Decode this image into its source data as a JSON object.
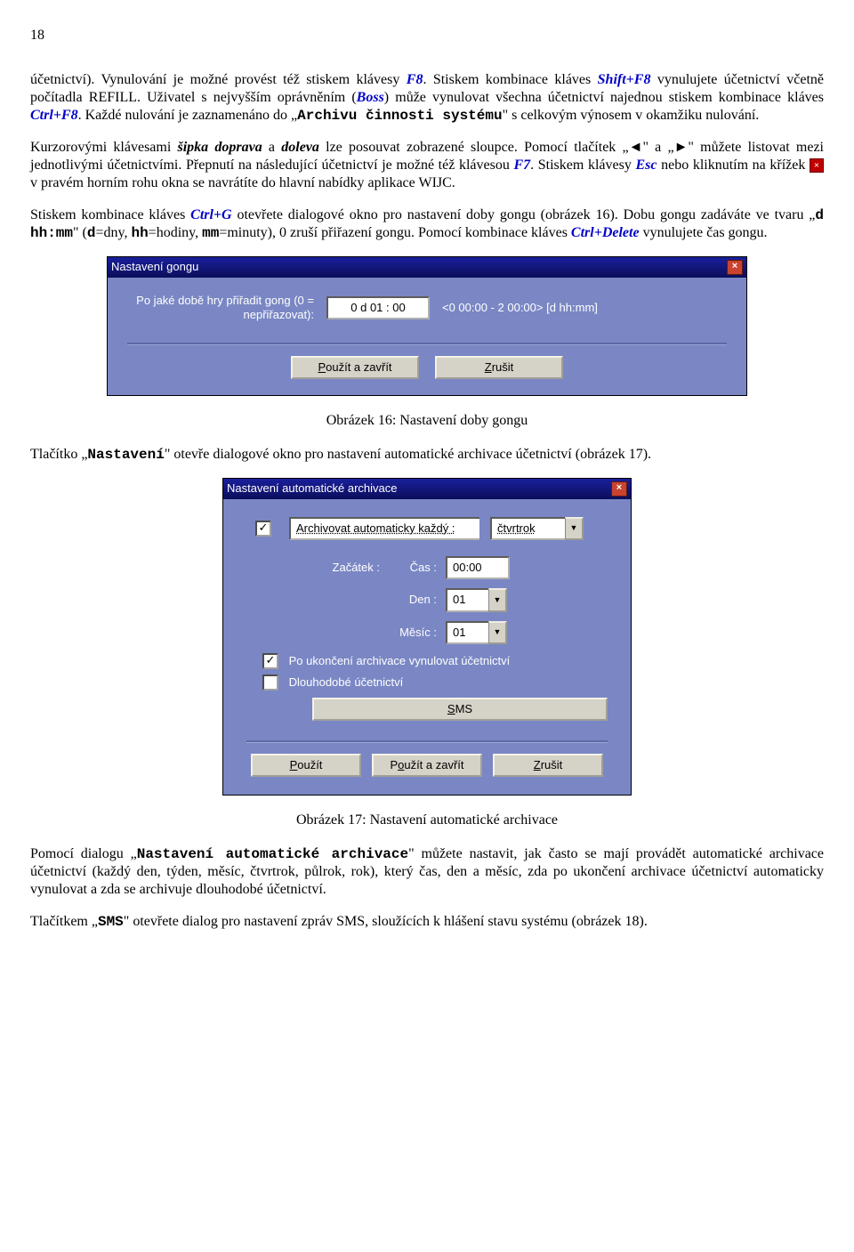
{
  "page_number": "18",
  "para1": {
    "seg1": "účetnictví). Vynulování je možné provést též stiskem klávesy ",
    "k1": "F8",
    "seg2": ". Stiskem kombinace kláves ",
    "k2": "Shift+F8",
    "seg3": " vynulujete účetnictví včetně počítadla REFILL. Uživatel s nejvyšším oprávněním (",
    "k3": "Boss",
    "seg4": ") může vynulovat všechna účetnictví najednou stiskem kombinace kláves ",
    "k4": "Ctrl+F8",
    "seg5": ". Každé nulování je zaznamenáno do „",
    "m1": "Archivu činnosti systému",
    "seg6": "\" s celkovým výnosem v okamžiku nulování."
  },
  "para2": {
    "seg1": "Kurzorovými klávesami ",
    "b1": "šipka doprava",
    "seg2": " a ",
    "b2": "doleva",
    "seg3": " lze posouvat zobrazené sloupce. Pomocí tlačítek „◄\" a „►\" můžete listovat mezi jednotlivými účetnictvími. Přepnutí na následující účetnictví je možné též klávesou ",
    "k1": "F7",
    "seg4": ". Stiskem klávesy ",
    "k2": "Esc",
    "seg5": " nebo kliknutím na křížek ",
    "seg6": " v pravém horním rohu okna se navrátíte do hlavní nabídky aplikace WIJC."
  },
  "para3": {
    "seg1": "Stiskem kombinace kláves ",
    "k1": "Ctrl+G",
    "seg2": " otevřete dialogové okno pro nastavení doby gongu (obrázek 16). Dobu gongu zadáváte ve tvaru „",
    "m1": "d hh:mm",
    "seg3": "\" (",
    "m2": "d",
    "seg4": "=dny, ",
    "m3": "hh",
    "seg5": "=hodiny, ",
    "m4": "mm",
    "seg6": "=minuty), 0 zruší přiřazení gongu. Pomocí kombinace kláves ",
    "k2": "Ctrl+Delete",
    "seg7": " vynulujete čas gongu."
  },
  "dialog1": {
    "title": "Nastavení gongu",
    "label": "Po jaké době hry přiřadit gong (0 = nepřiřazovat):",
    "value": "0 d 01 : 00",
    "hint": "<0 00:00 - 2 00:00> [d hh:mm]",
    "btn_apply_close": "Použít a zavřít",
    "btn_cancel": "Zrušit"
  },
  "caption1": "Obrázek 16: Nastavení doby gongu",
  "para4": {
    "seg1": "Tlačítko „",
    "m1": "Nastavení",
    "seg2": "\" otevře dialogové okno pro nastavení automatické archivace účetnictví (obrázek 17)."
  },
  "dialog2": {
    "title": "Nastavení automatické archivace",
    "chk_auto": "Archivovat automaticky každý :",
    "period_value": "čtvrtrok",
    "start_label": "Začátek :",
    "time_label": "Čas :",
    "time_value": "00:00",
    "day_label": "Den :",
    "day_value": "01",
    "month_label": "Měsíc :",
    "month_value": "01",
    "chk_reset": "Po ukončení archivace vynulovat účetnictví",
    "chk_long": "Dlouhodobé účetnictví",
    "btn_sms": "SMS",
    "btn_apply": "Použít",
    "btn_apply_close": "Použít a zavřít",
    "btn_cancel": "Zrušit"
  },
  "caption2": "Obrázek 17: Nastavení automatické archivace",
  "para5": {
    "seg1": "Pomocí dialogu „",
    "m1": "Nastavení automatické archivace",
    "seg2": "\" můžete nastavit, jak často se mají provádět automatické archivace účetnictví (každý den, týden, měsíc, čtvrtrok, půlrok, rok), který čas, den a měsíc, zda po ukončení archivace účetnictví automaticky vynulovat a zda se archivuje dlouhodobé účetnictví."
  },
  "para6": {
    "seg1": "Tlačítkem „",
    "m1": "SMS",
    "seg2": "\" otevřete dialog pro nastavení zpráv SMS, sloužících k hlášení stavu systému (obrázek 18)."
  }
}
